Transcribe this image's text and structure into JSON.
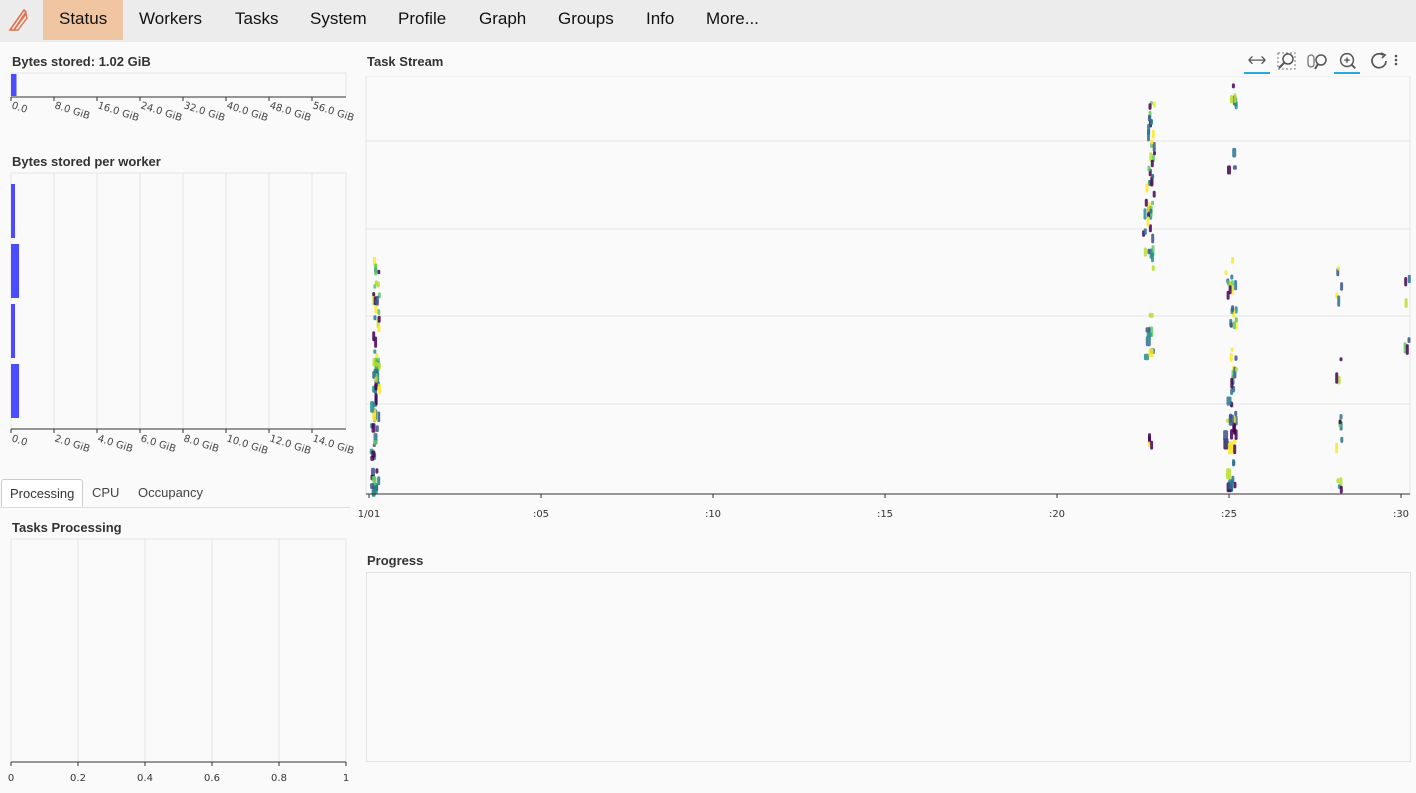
{
  "nav": {
    "items": [
      {
        "label": "Status",
        "active": true
      },
      {
        "label": "Workers"
      },
      {
        "label": "Tasks"
      },
      {
        "label": "System"
      },
      {
        "label": "Profile"
      },
      {
        "label": "Graph"
      },
      {
        "label": "Groups"
      },
      {
        "label": "Info"
      },
      {
        "label": "More..."
      }
    ],
    "logo_icon": "dask-logo-icon"
  },
  "bytes_stored": {
    "title": "Bytes stored: 1.02 GiB",
    "ticks": [
      "0.0",
      "8.0 GiB",
      "16.0 GiB",
      "24.0 GiB",
      "32.0 GiB",
      "40.0 GiB",
      "48.0 GiB",
      "56.0 GiB"
    ],
    "value_gib": 1.02,
    "bar_color": "#4b4bff"
  },
  "bytes_per_worker": {
    "title": "Bytes stored per worker",
    "ticks": [
      "0.0",
      "2.0 GiB",
      "4.0 GiB",
      "6.0 GiB",
      "8.0 GiB",
      "10.0 GiB",
      "12.0 GiB",
      "14.0 GiB"
    ],
    "values_gib": [
      0.25,
      0.5,
      0.25,
      0.5
    ]
  },
  "tabs": [
    "Processing",
    "CPU",
    "Occupancy"
  ],
  "tasks_processing": {
    "title": "Tasks Processing",
    "ticks": [
      "0",
      "0.2",
      "0.4",
      "0.6",
      "0.8",
      "1"
    ]
  },
  "task_stream": {
    "title": "Task Stream",
    "x_ticks": [
      "1/01",
      ":05",
      ":10",
      ":15",
      ":20",
      ":25",
      ":30"
    ],
    "tools": [
      "pan-icon",
      "box-zoom-icon",
      "wheel-zoom-icon",
      "reset-zoom-icon",
      "refresh-icon",
      "more-icon"
    ]
  },
  "progress": {
    "title": "Progress"
  },
  "colors": {
    "viridis": [
      "#440154",
      "#3b528b",
      "#21918c",
      "#5ec962",
      "#fde725",
      "#2c728e",
      "#b5de2b"
    ]
  }
}
